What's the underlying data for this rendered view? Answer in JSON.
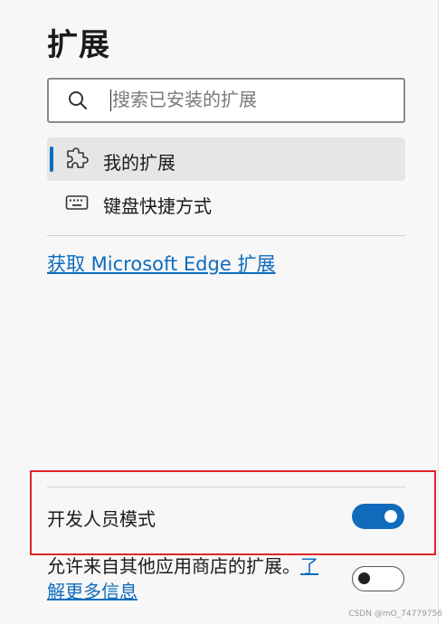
{
  "header": {
    "title": "扩展"
  },
  "search": {
    "placeholder": "搜索已安装的扩展"
  },
  "nav": {
    "items": [
      {
        "label": "我的扩展",
        "icon": "puzzle-icon",
        "active": true
      },
      {
        "label": "键盘快捷方式",
        "icon": "keyboard-icon",
        "active": false
      }
    ]
  },
  "get_extensions_link": "获取 Microsoft Edge 扩展",
  "developer_mode": {
    "label": "开发人员模式",
    "enabled": true
  },
  "allow_other_stores": {
    "text": "允许来自其他应用商店的扩展。",
    "link_part1": "了",
    "link_part2": "解更多信息",
    "enabled": false
  },
  "watermark": "CSDN @mO_74779756",
  "colors": {
    "accent": "#0f6cbd",
    "highlight_box": "#e0242a"
  }
}
